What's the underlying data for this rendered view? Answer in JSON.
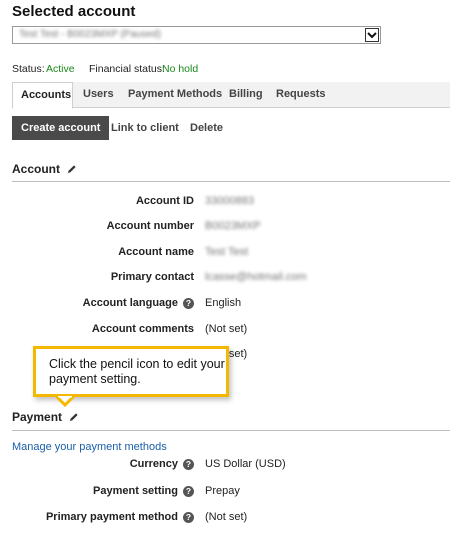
{
  "selected_account": {
    "title": "Selected account",
    "value": "Test Test - B0023MXP (Paused)"
  },
  "status": {
    "status_label": "Status:",
    "status_value": "Active",
    "financial_label": "Financial status:",
    "financial_value": "No hold"
  },
  "tabs": [
    {
      "label": "Accounts"
    },
    {
      "label": "Users"
    },
    {
      "label": "Payment Methods"
    },
    {
      "label": "Billing"
    },
    {
      "label": "Requests"
    }
  ],
  "actions": {
    "create": "Create account",
    "link": "Link to client",
    "delete": "Delete"
  },
  "account": {
    "title": "Account",
    "rows": [
      {
        "label": "Account ID",
        "value": "33000883"
      },
      {
        "label": "Account number",
        "value": "B0023MXP"
      },
      {
        "label": "Account name",
        "value": "Test Test"
      },
      {
        "label": "Primary contact",
        "value": "lcasse@hotmail.com"
      },
      {
        "label": "Account language",
        "value": "English"
      },
      {
        "label": "Account comments",
        "value": "(Not set)"
      },
      {
        "label": "",
        "value": "(Not set)"
      }
    ]
  },
  "callout": {
    "text": "Click the pencil icon to edit your payment setting."
  },
  "payment": {
    "title": "Payment",
    "manage_link": "Manage your payment methods",
    "rows": [
      {
        "label": "Currency",
        "value": "US Dollar (USD)"
      },
      {
        "label": "Payment setting",
        "value": "Prepay"
      },
      {
        "label": "Primary payment method",
        "value": "(Not set)"
      }
    ]
  },
  "colors": {
    "accent_callout": "#f5b800",
    "status_green": "#1a8a1a",
    "link_blue": "#1a5fa8"
  }
}
